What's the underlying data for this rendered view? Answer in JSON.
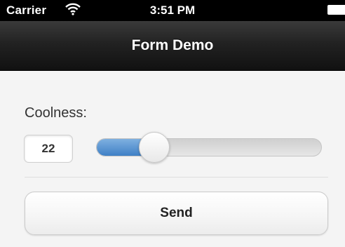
{
  "status_bar": {
    "carrier": "Carrier",
    "time": "3:51 PM",
    "wifi_icon": "wifi-icon",
    "battery_icon": "battery-icon"
  },
  "nav_bar": {
    "title": "Form Demo"
  },
  "form": {
    "slider_label": "Coolness:",
    "slider_value": "22",
    "slider_min": 0,
    "slider_max": 100,
    "slider_fill_color": "#3f80c6",
    "send_label": "Send"
  }
}
